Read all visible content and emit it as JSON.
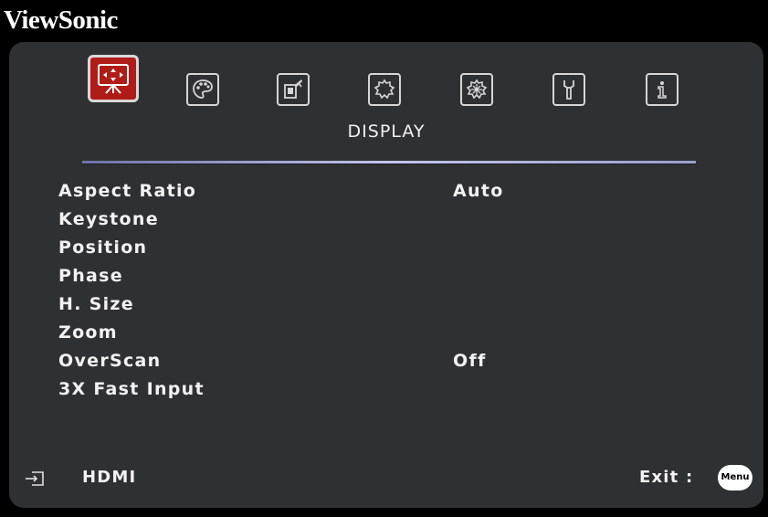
{
  "brand": {
    "name": "ViewSonic"
  },
  "tabs": [
    {
      "icon": "display-icon",
      "active": true
    },
    {
      "icon": "picture-palette-icon",
      "active": false
    },
    {
      "icon": "power-management-icon",
      "active": false
    },
    {
      "icon": "basic-settings-gear-icon",
      "active": false
    },
    {
      "icon": "advanced-settings-gear-icon",
      "active": false
    },
    {
      "icon": "system-wrench-icon",
      "active": false
    },
    {
      "icon": "information-icon",
      "active": false
    }
  ],
  "section": {
    "title": "DISPLAY"
  },
  "menu": {
    "items": [
      {
        "label": "Aspect Ratio",
        "value": "Auto"
      },
      {
        "label": "Keystone",
        "value": ""
      },
      {
        "label": "Position",
        "value": ""
      },
      {
        "label": "Phase",
        "value": ""
      },
      {
        "label": "H. Size",
        "value": ""
      },
      {
        "label": "Zoom",
        "value": ""
      },
      {
        "label": "OverScan",
        "value": "Off"
      },
      {
        "label": "3X Fast Input",
        "value": ""
      }
    ]
  },
  "footer": {
    "source_icon": "input-source-icon",
    "source_label": "HDMI",
    "exit_label": "Exit :",
    "menu_key_label": "Menu"
  },
  "colors": {
    "active_tab": "#b01c18",
    "panel": "#2f3032",
    "text": "#f2f2f2",
    "rule": "#c3c6ea"
  }
}
